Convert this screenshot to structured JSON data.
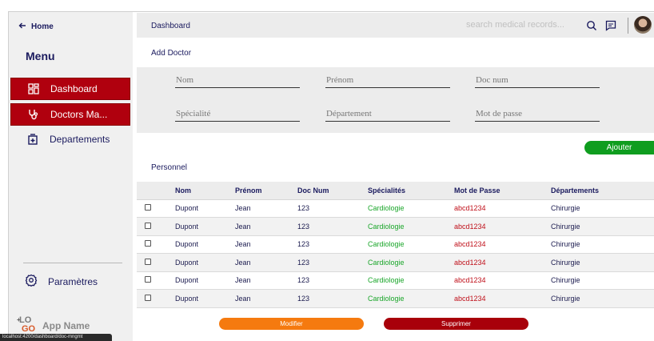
{
  "sidebar": {
    "home_label": "Home",
    "menu_title": "Menu",
    "items": [
      {
        "label": "Dashboard",
        "icon": "dashboard-grid-icon"
      },
      {
        "label": "Doctors Ma...",
        "icon": "stethoscope-icon"
      },
      {
        "label": "Departements",
        "icon": "hospital-icon"
      }
    ],
    "settings_label": "Paramètres",
    "app_name": "App Name",
    "logo_text_top": "LO",
    "logo_text_bottom": "GO",
    "active_color": "#b0000e"
  },
  "statusbar": {
    "url": "localhost:4200/dashboard/doc-mngmt"
  },
  "topbar": {
    "breadcrumb": "Dashboard",
    "search_placeholder": "search medical records..."
  },
  "form": {
    "title": "Add Doctor",
    "fields": {
      "nom": "Nom",
      "prenom": "Prénom",
      "doc_num": "Doc num",
      "specialite": "Spécialité",
      "departement": "Département",
      "mot_de_passe": "Mot de passe"
    },
    "add_button": "Ajouter"
  },
  "personnel": {
    "title": "Personnel",
    "columns": [
      "Nom",
      "Prénom",
      "Doc Num",
      "Spécialités",
      "Mot de Passe",
      "Départements"
    ],
    "rows": [
      [
        "Dupont",
        "Jean",
        "123",
        "Cardiologie",
        "abcd1234",
        "Chirurgie"
      ],
      [
        "Dupont",
        "Jean",
        "123",
        "Cardiologie",
        "abcd1234",
        "Chirurgie"
      ],
      [
        "Dupont",
        "Jean",
        "123",
        "Cardiologie",
        "abcd1234",
        "Chirurgie"
      ],
      [
        "Dupont",
        "Jean",
        "123",
        "Cardiologie",
        "abcd1234",
        "Chirurgie"
      ],
      [
        "Dupont",
        "Jean",
        "123",
        "Cardiologie",
        "abcd1234",
        "Chirurgie"
      ],
      [
        "Dupont",
        "Jean",
        "123",
        "Cardiologie",
        "abcd1234",
        "Chirurgie"
      ]
    ]
  },
  "actions": {
    "modify": "Modifier",
    "delete": "Supprimer"
  },
  "colors": {
    "add": "#0f9d1f",
    "modify": "#f57a0f",
    "delete": "#a8000a"
  }
}
